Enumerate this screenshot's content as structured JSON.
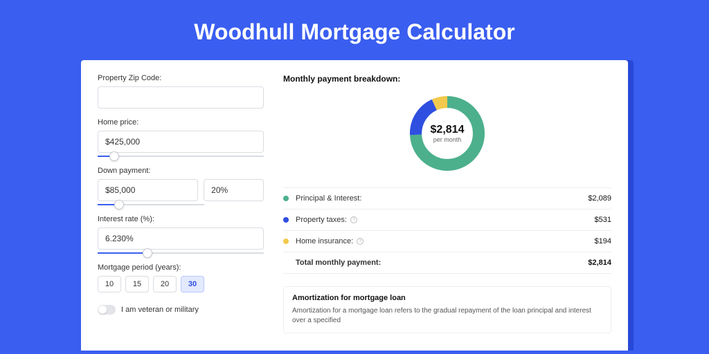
{
  "title": "Woodhull Mortgage Calculator",
  "form": {
    "zip": {
      "label": "Property Zip Code:",
      "value": ""
    },
    "price": {
      "label": "Home price:",
      "value": "$425,000",
      "slider_pct": 10
    },
    "down": {
      "label": "Down payment:",
      "amount": "$85,000",
      "pct": "20%",
      "slider_pct": 20
    },
    "rate": {
      "label": "Interest rate (%):",
      "value": "6.230%",
      "slider_pct": 30
    },
    "period": {
      "label": "Mortgage period (years):",
      "options": [
        "10",
        "15",
        "20",
        "30"
      ],
      "selected": "30"
    },
    "veteran": {
      "label": "I am veteran or military",
      "on": false
    }
  },
  "breakdown": {
    "title": "Monthly payment breakdown:",
    "center_value": "$2,814",
    "center_sub": "per month",
    "items": [
      {
        "label": "Principal & Interest:",
        "amount": "$2,089",
        "color": "#4cb08c",
        "info": false,
        "pct": 74.2
      },
      {
        "label": "Property taxes:",
        "amount": "$531",
        "color": "#2e4fe0",
        "info": true,
        "pct": 18.9
      },
      {
        "label": "Home insurance:",
        "amount": "$194",
        "color": "#f2c94c",
        "info": true,
        "pct": 6.9
      }
    ],
    "total": {
      "label": "Total monthly payment:",
      "amount": "$2,814"
    }
  },
  "amort": {
    "title": "Amortization for mortgage loan",
    "text": "Amortization for a mortgage loan refers to the gradual repayment of the loan principal and interest over a specified"
  },
  "chart_data": {
    "type": "pie",
    "title": "Monthly payment breakdown",
    "series": [
      {
        "name": "Principal & Interest",
        "value": 2089
      },
      {
        "name": "Property taxes",
        "value": 531
      },
      {
        "name": "Home insurance",
        "value": 194
      }
    ],
    "total": 2814,
    "unit": "$ per month"
  }
}
